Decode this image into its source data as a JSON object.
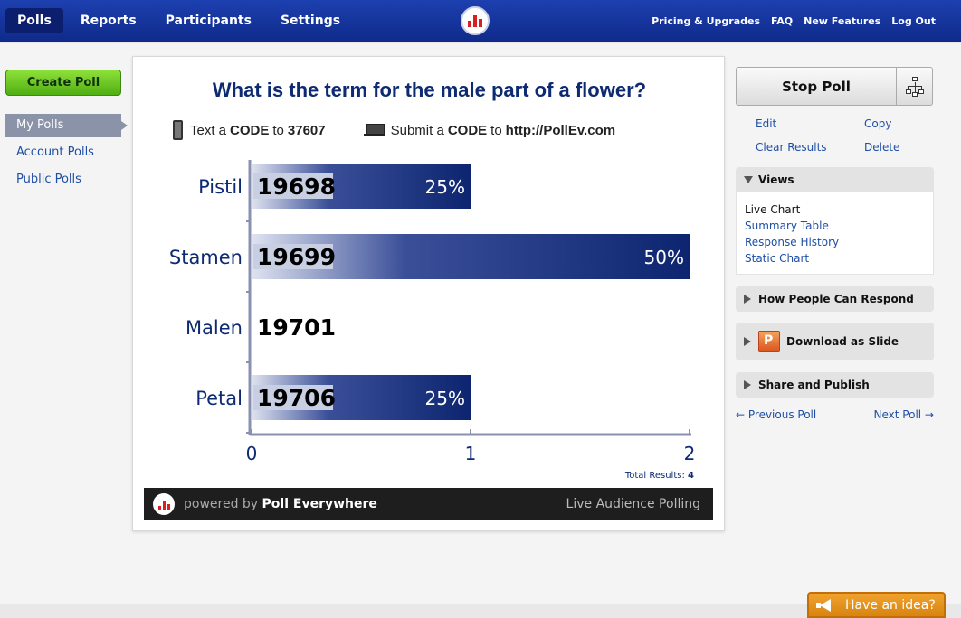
{
  "nav": {
    "left": [
      "Polls",
      "Reports",
      "Participants",
      "Settings"
    ],
    "active_index": 0,
    "right": [
      "Pricing & Upgrades",
      "FAQ",
      "New Features",
      "Log Out"
    ]
  },
  "sidebar": {
    "create_label": "Create Poll",
    "items": [
      "My Polls",
      "Account Polls",
      "Public Polls"
    ],
    "active_index": 0
  },
  "poll": {
    "question": "What is the term for the male part of a flower?",
    "text_prefix": "Text a",
    "text_code": "CODE",
    "text_to": "to",
    "text_number": "37607",
    "submit_prefix": "Submit a",
    "submit_code": "CODE",
    "submit_to": "to",
    "submit_url": "http://PollEv.com",
    "total_label": "Total Results:",
    "total_value": "4"
  },
  "chart_data": {
    "type": "bar",
    "orientation": "horizontal",
    "categories": [
      "Pistil",
      "Stamen",
      "Malen",
      "Petal"
    ],
    "codes": [
      "19698",
      "19699",
      "19701",
      "19706"
    ],
    "values": [
      1,
      2,
      0,
      1
    ],
    "percent_labels": [
      "25%",
      "50%",
      "",
      "25%"
    ],
    "xlim": [
      0,
      2
    ],
    "xticks": [
      "0",
      "1",
      "2"
    ],
    "colors": {
      "bar_dark": "#0d2570",
      "bar_light": "#c9cfe3",
      "axis": "#8a90b0"
    }
  },
  "footer": {
    "powered_by": "powered by",
    "brand": "Poll Everywhere",
    "tagline": "Live Audience Polling"
  },
  "right": {
    "stop_label": "Stop Poll",
    "actions": [
      "Edit",
      "Copy",
      "Clear Results",
      "Delete"
    ],
    "views_title": "Views",
    "views": [
      "Live Chart",
      "Summary Table",
      "Response History",
      "Static Chart"
    ],
    "views_current_index": 0,
    "respond_title": "How People Can Respond",
    "download_title": "Download as Slide",
    "share_title": "Share and Publish",
    "prev": "← Previous Poll",
    "next": "Next Poll →"
  },
  "feedback": {
    "label": "Have an idea?"
  }
}
